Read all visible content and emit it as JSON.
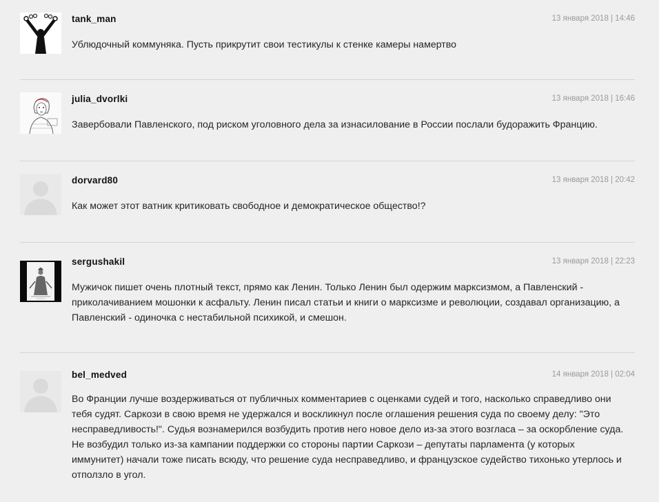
{
  "comments": [
    {
      "username": "tank_man",
      "date": "13 января 2018 | 14:46",
      "avatar": "chained-arms-avatar",
      "text": "Ублюдочный коммуняка. Пусть прикрутит свои тестикулы к стенке камеры намертво"
    },
    {
      "username": "julia_dvorlki",
      "date": "13 января 2018 | 16:46",
      "avatar": "sketch-girl-avatar",
      "text": "Завербовали Павленского, под риском уголовного дела за изнасилование в России послали будоражить Францию."
    },
    {
      "username": "dorvard80",
      "date": "13 января 2018 | 20:42",
      "avatar": "default-user-avatar",
      "text": "Как может этот ватник критиковать свободное и демократическое общество!?"
    },
    {
      "username": "sergushakil",
      "date": "13 января 2018 | 22:23",
      "avatar": "engraving-figure-avatar",
      "text": "Мужичок пишет очень плотный текст, прямо как Ленин. Только Ленин был одержим марксизмом, а Павленский - приколачиванием мошонки к асфальту. Ленин писал статьи и книги о марксизме и революции, создавал организацию, а Павленский - одиночка с нестабильной психикой, и смешон."
    },
    {
      "username": "bel_medved",
      "date": "14 января 2018 | 02:04",
      "avatar": "default-user-avatar",
      "text": "Во Франции лучше воздерживаться от публичных комментариев с оценками судей и того, насколько справедливо они тебя судят. Саркози в свою время не удержался и воскликнул после оглашения решения суда по своему делу: \"Это несправедливость!\". Судья вознамерился возбудить против него новое дело из-за этого возгласа – за оскорбление суда. Не возбудил только из-за кампании поддержки со стороны партии Саркози – депутаты парламента (у которых иммунитет) начали тоже писать всюду, что решение суда несправедливо, и французское судейство тихонько утерлось и отползло в угол."
    }
  ]
}
